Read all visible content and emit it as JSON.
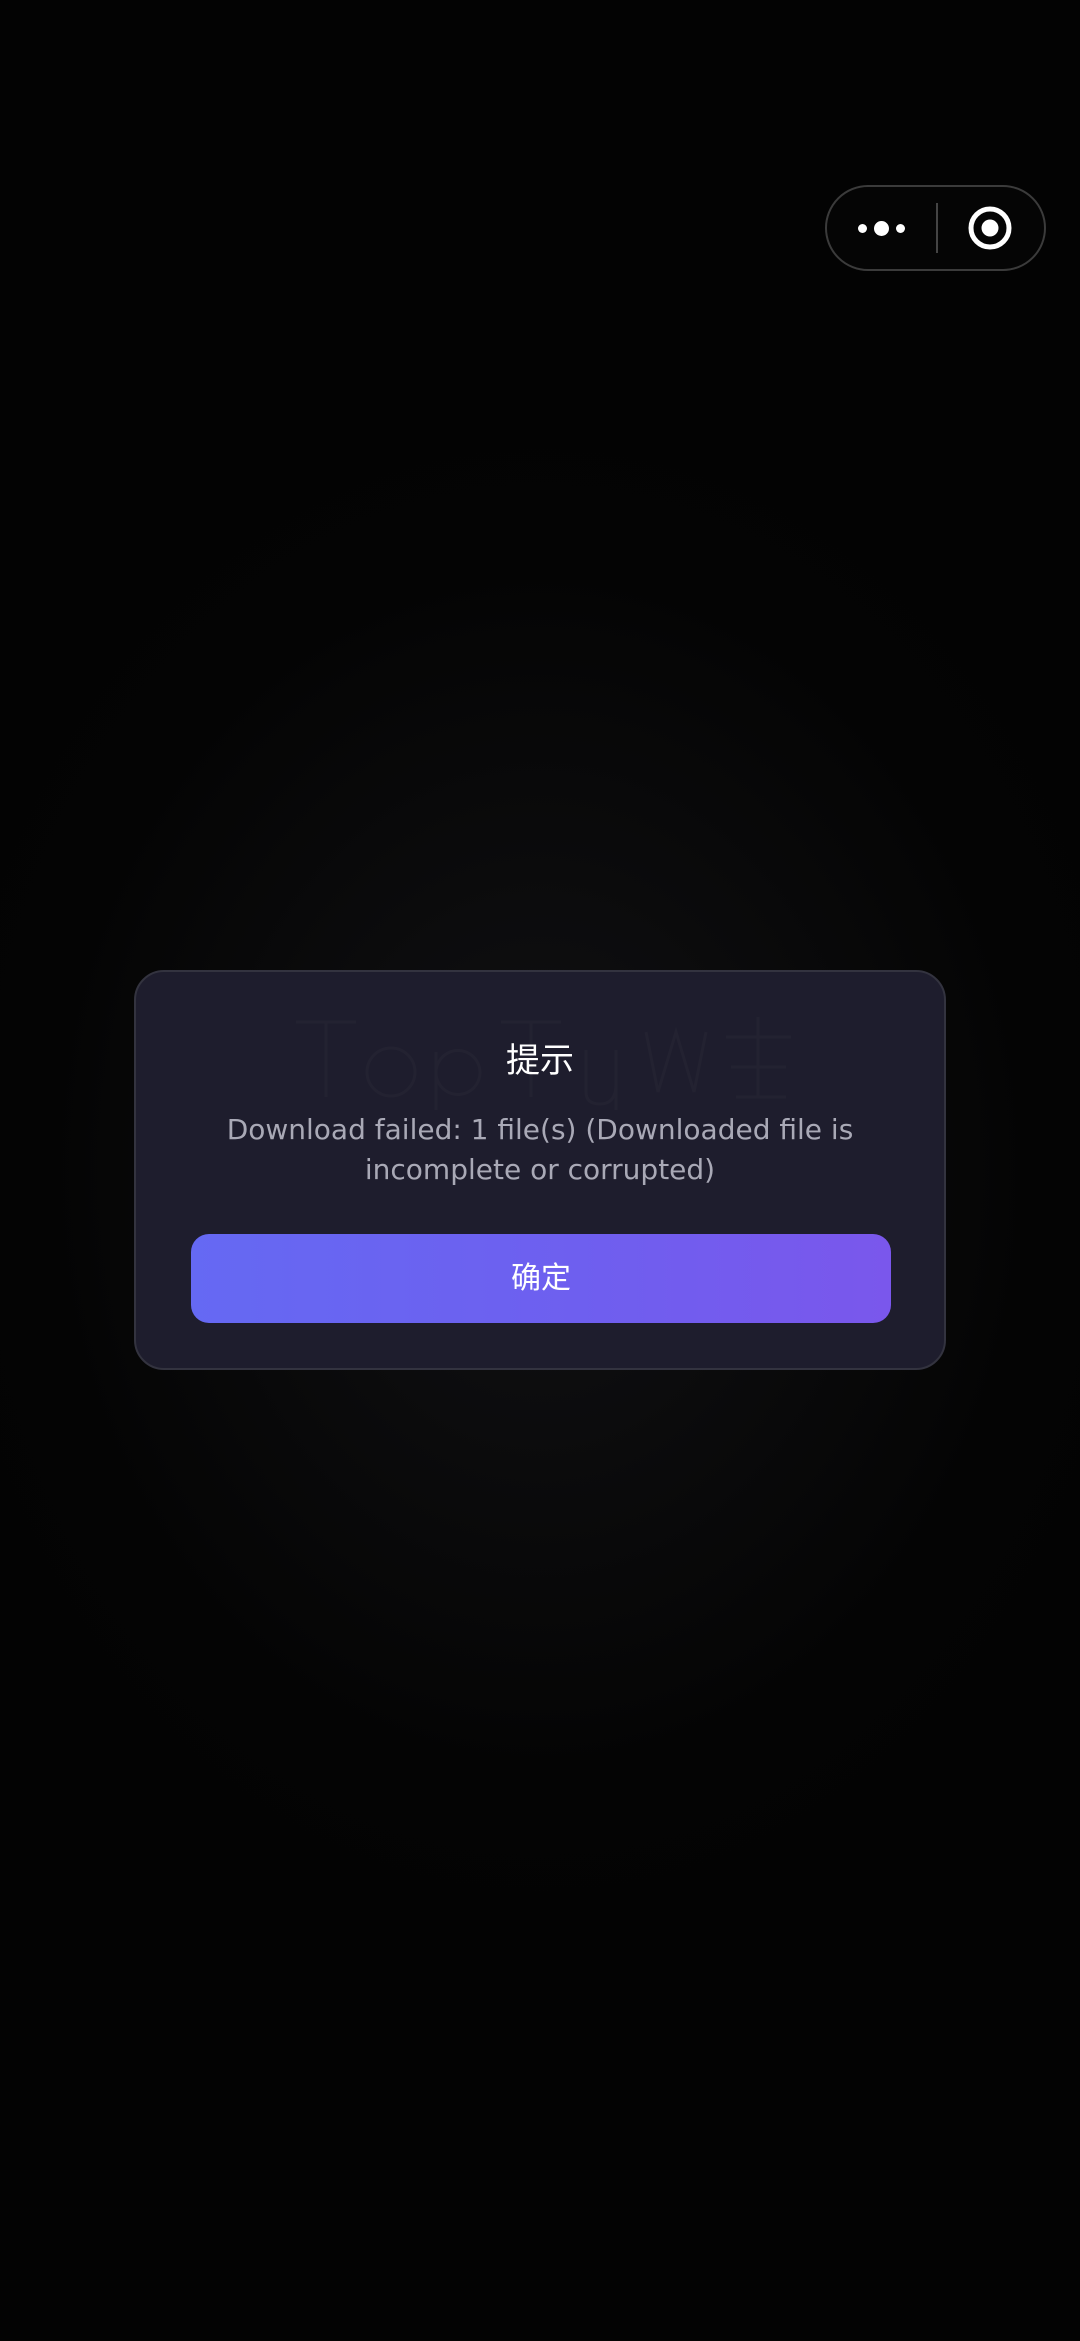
{
  "capsule": {
    "more_icon": "more-dots-icon",
    "close_icon": "target-close-icon"
  },
  "dialog": {
    "title": "提示",
    "message": "Download failed: 1 file(s) (Downloaded file is incomplete or corrupted)",
    "confirm_label": "确定"
  },
  "colors": {
    "background": "#030303",
    "dialog_bg": "#1e1d2d",
    "button_gradient_start": "#6569f3",
    "button_gradient_end": "#7a57ec",
    "message_text": "#a9a9b6"
  }
}
